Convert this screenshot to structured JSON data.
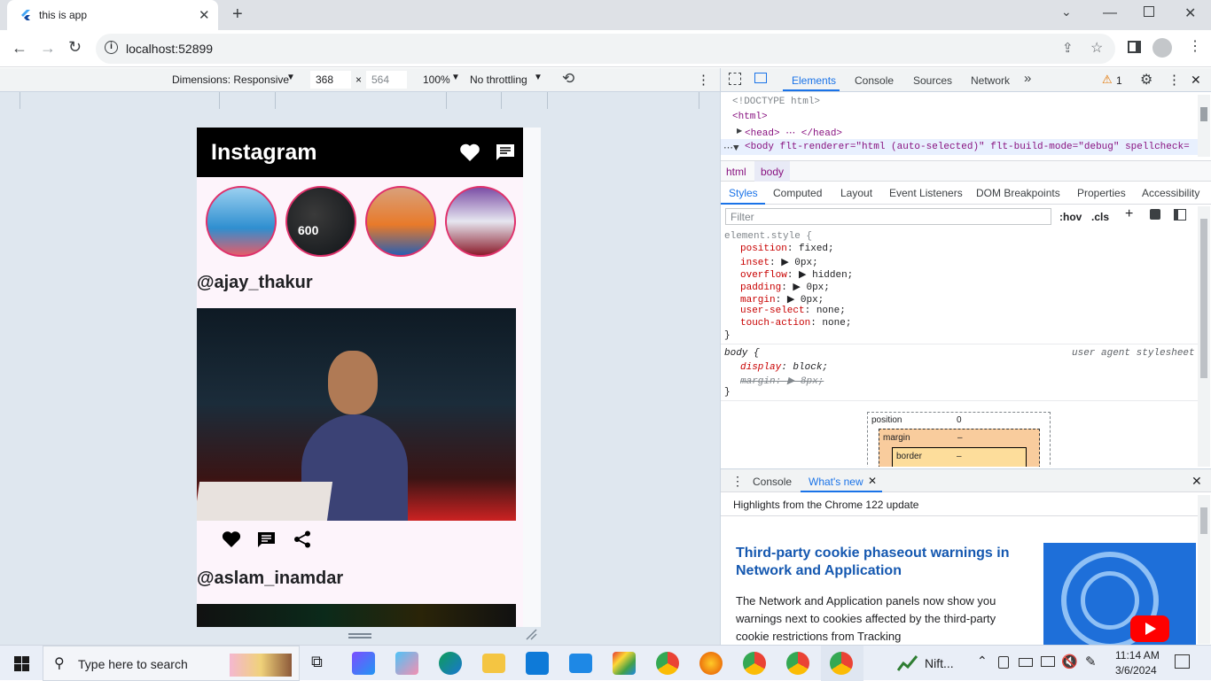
{
  "browser": {
    "tab_title": "this is app",
    "url": "localhost:52899"
  },
  "device_toolbar": {
    "dimensions_label": "Dimensions: Responsive",
    "width": "368",
    "height": "564",
    "zoom": "100%",
    "throttling": "No throttling"
  },
  "app": {
    "title": "Instagram",
    "posts": [
      {
        "username": "@ajay_thakur"
      },
      {
        "username": "@aslam_inamdar"
      }
    ],
    "stories_count": 4
  },
  "devtools": {
    "main_tabs": [
      "Elements",
      "Console",
      "Sources",
      "Network"
    ],
    "issues_count": "1",
    "dom_lines": [
      "<!DOCTYPE html>",
      "<html>",
      "<head> ⋯ </head>",
      "<body flt-renderer=\"html (auto-selected)\" flt-build-mode=\"debug\" spellcheck="
    ],
    "breadcrumb": [
      "html",
      "body"
    ],
    "style_tabs": [
      "Styles",
      "Computed",
      "Layout",
      "Event Listeners",
      "DOM Breakpoints",
      "Properties",
      "Accessibility"
    ],
    "filter_placeholder": "Filter",
    "hov": ":hov",
    "cls": ".cls",
    "element_style_selector": "element.style {",
    "element_style_props": [
      {
        "name": "position",
        "value": "fixed;"
      },
      {
        "name": "inset",
        "value": "▶ 0px;"
      },
      {
        "name": "overflow",
        "value": "▶ hidden;"
      },
      {
        "name": "padding",
        "value": "▶ 0px;"
      },
      {
        "name": "margin",
        "value": "▶ 0px;"
      },
      {
        "name": "user-select",
        "value": "none;"
      },
      {
        "name": "touch-action",
        "value": "none;"
      }
    ],
    "close_brace": "}",
    "body_selector": "body {",
    "ua_label": "user agent stylesheet",
    "body_props": [
      {
        "name": "display",
        "value": "block;"
      },
      {
        "name": "margin",
        "value": "▶ 8px;"
      }
    ],
    "box_model": {
      "position": "position",
      "position_value": "0",
      "margin": "margin",
      "margin_value": "–",
      "border": "border",
      "border_value": "–"
    },
    "drawer_tabs": [
      "Console",
      "What's new"
    ],
    "highlights": "Highlights from the Chrome 122 update",
    "article_title": "Third-party cookie phaseout warnings in Network and Application",
    "article_body": "The Network and Application panels now show you warnings next to cookies affected by the third-party cookie restrictions from Tracking"
  },
  "taskbar": {
    "search_placeholder": "Type here to search",
    "nifty_label": "Nift...",
    "time": "11:14 AM",
    "date": "3/6/2024"
  },
  "colors": {
    "accent": "#1a73e8",
    "app_bar": "#000000",
    "story_ring": "#e0306b",
    "link_blue": "#1558b0"
  }
}
